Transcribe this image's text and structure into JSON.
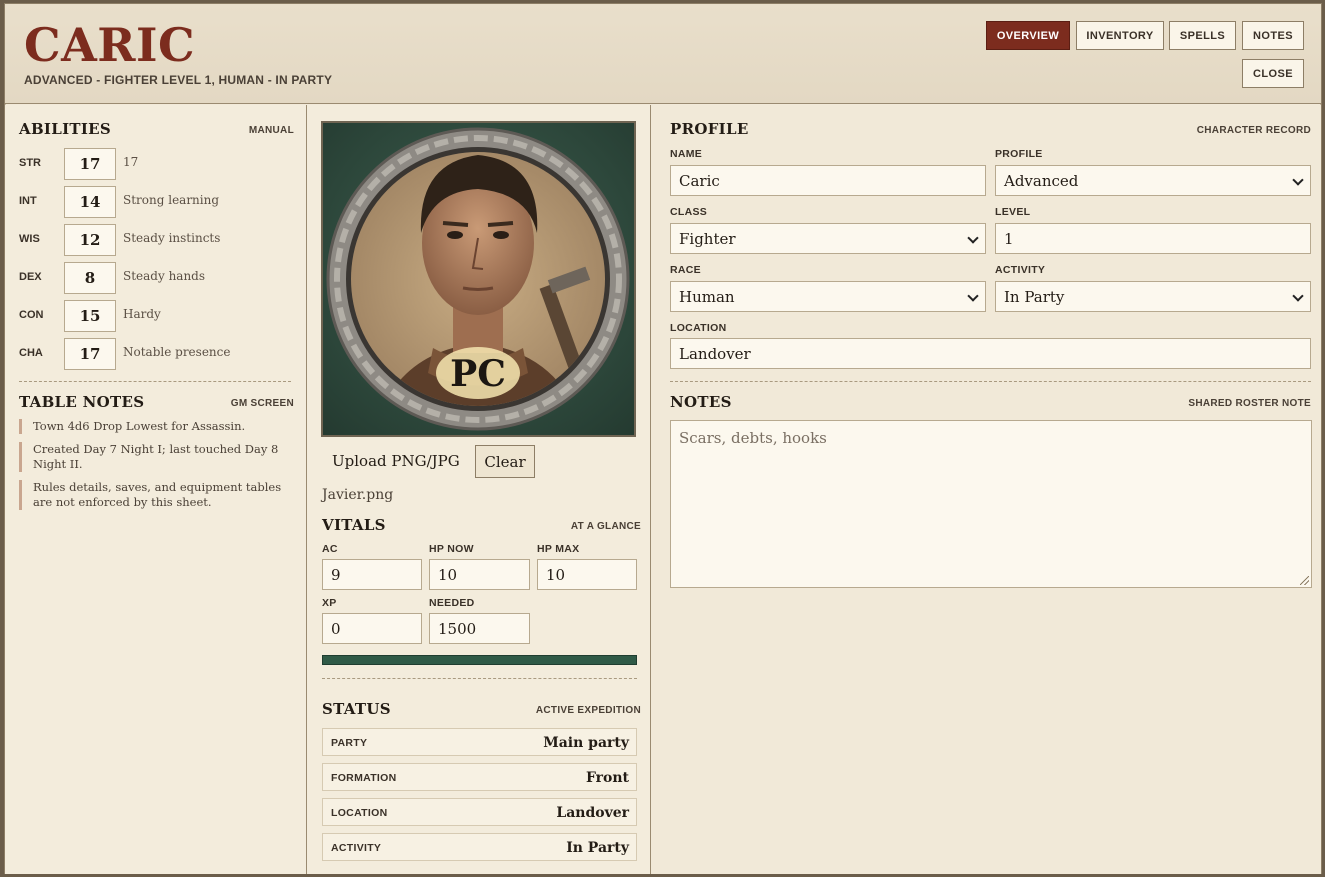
{
  "header": {
    "title": "CARIC",
    "subtitle": "ADVANCED - FIGHTER LEVEL 1, HUMAN - IN PARTY",
    "tabs": [
      {
        "label": "OVERVIEW",
        "active": true
      },
      {
        "label": "INVENTORY",
        "active": false
      },
      {
        "label": "SPELLS",
        "active": false
      },
      {
        "label": "NOTES",
        "active": false
      }
    ],
    "close_label": "CLOSE"
  },
  "abilities": {
    "title": "ABILITIES",
    "tag": "MANUAL",
    "rows": [
      {
        "label": "STR",
        "value": "17",
        "note": "17"
      },
      {
        "label": "INT",
        "value": "14",
        "note": "Strong learning"
      },
      {
        "label": "WIS",
        "value": "12",
        "note": "Steady instincts"
      },
      {
        "label": "DEX",
        "value": "8",
        "note": "Steady hands"
      },
      {
        "label": "CON",
        "value": "15",
        "note": "Hardy"
      },
      {
        "label": "CHA",
        "value": "17",
        "note": "Notable presence"
      }
    ]
  },
  "table_notes": {
    "title": "TABLE NOTES",
    "tag": "GM SCREEN",
    "items": [
      "Town 4d6 Drop Lowest for Assassin.",
      "Created Day 7 Night I; last touched Day 8 Night II.",
      "Rules details, saves, and equipment tables are not enforced by this sheet."
    ]
  },
  "portrait": {
    "badge": "PC",
    "upload_label": "Upload PNG/JPG",
    "clear_label": "Clear",
    "filename": "Javier.png"
  },
  "vitals": {
    "title": "VITALS",
    "tag": "AT A GLANCE",
    "ac_label": "AC",
    "ac": "9",
    "hp_now_label": "HP NOW",
    "hp_now": "10",
    "hp_max_label": "HP MAX",
    "hp_max": "10",
    "xp_label": "XP",
    "xp": "0",
    "needed_label": "NEEDED",
    "needed": "1500"
  },
  "status": {
    "title": "STATUS",
    "tag": "ACTIVE EXPEDITION",
    "rows": [
      {
        "key": "PARTY",
        "value": "Main party"
      },
      {
        "key": "FORMATION",
        "value": "Front"
      },
      {
        "key": "LOCATION",
        "value": "Landover"
      },
      {
        "key": "ACTIVITY",
        "value": "In Party"
      }
    ]
  },
  "profile": {
    "title": "PROFILE",
    "tag": "CHARACTER RECORD",
    "name_label": "NAME",
    "name": "Caric",
    "profile_label": "PROFILE",
    "profile": "Advanced",
    "class_label": "CLASS",
    "class": "Fighter",
    "level_label": "LEVEL",
    "level": "1",
    "race_label": "RACE",
    "race": "Human",
    "activity_label": "ACTIVITY",
    "activity": "In Party",
    "location_label": "LOCATION",
    "location": "Landover"
  },
  "notes": {
    "title": "NOTES",
    "tag": "SHARED ROSTER NOTE",
    "placeholder": "Scars, debts, hooks"
  },
  "colors": {
    "accent": "#7c2c1e",
    "panel": "#f2ead9",
    "progress": "#2f5a47"
  }
}
